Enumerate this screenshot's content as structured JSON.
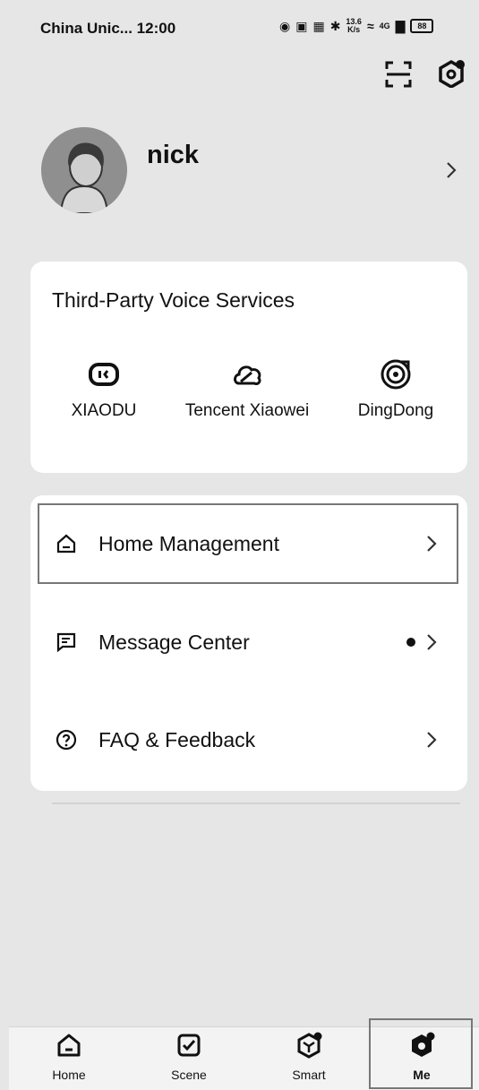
{
  "status_bar": {
    "carrier_time": "China Unic... 12:00",
    "speed": "13.6",
    "speed_unit": "K/s",
    "network": "4G",
    "battery": "88"
  },
  "profile": {
    "username": "nick"
  },
  "voice_services": {
    "title": "Third-Party Voice Services",
    "items": [
      {
        "label": "XIAODU",
        "icon": "xiaodu-icon"
      },
      {
        "label": "Tencent Xiaowei",
        "icon": "cloud-icon"
      },
      {
        "label": "DingDong",
        "icon": "dingdong-icon"
      }
    ]
  },
  "menu": {
    "items": [
      {
        "label": "Home Management",
        "icon": "house-icon"
      },
      {
        "label": "Message Center",
        "icon": "message-icon",
        "has_dot": true
      },
      {
        "label": "FAQ & Feedback",
        "icon": "question-icon"
      }
    ]
  },
  "bottom_nav": {
    "items": [
      {
        "label": "Home",
        "icon": "home-icon"
      },
      {
        "label": "Scene",
        "icon": "checkbox-icon"
      },
      {
        "label": "Smart",
        "icon": "cube-icon"
      },
      {
        "label": "Me",
        "icon": "profile-icon",
        "active": true
      }
    ]
  }
}
